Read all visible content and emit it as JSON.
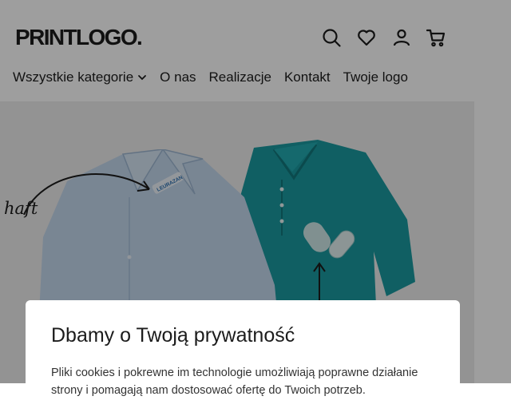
{
  "header": {
    "logo": "PRINTLOGO.",
    "icons": [
      "search-icon",
      "heart-icon",
      "user-icon",
      "cart-icon"
    ]
  },
  "nav": {
    "items": [
      {
        "label": "Wszystkie kategorie",
        "has_dropdown": true
      },
      {
        "label": "O nas"
      },
      {
        "label": "Realizacje"
      },
      {
        "label": "Kontakt"
      },
      {
        "label": "Twoje logo"
      }
    ]
  },
  "hero": {
    "annotation": "haft",
    "collar_badge": "LEURAZAN"
  },
  "cookie_modal": {
    "title": "Dbamy o Twoją prywatność",
    "text": "Pliki cookies i pokrewne im technologie umożliwiają poprawne działanie strony i pomagają nam dostosować ofertę do Twoich potrzeb."
  },
  "colors": {
    "text": "#1c1c1c",
    "shirt_blue": "#c4d8ee",
    "shirt_teal": "#1a9aa0",
    "overlay": "rgba(0,0,0,0.38)"
  }
}
